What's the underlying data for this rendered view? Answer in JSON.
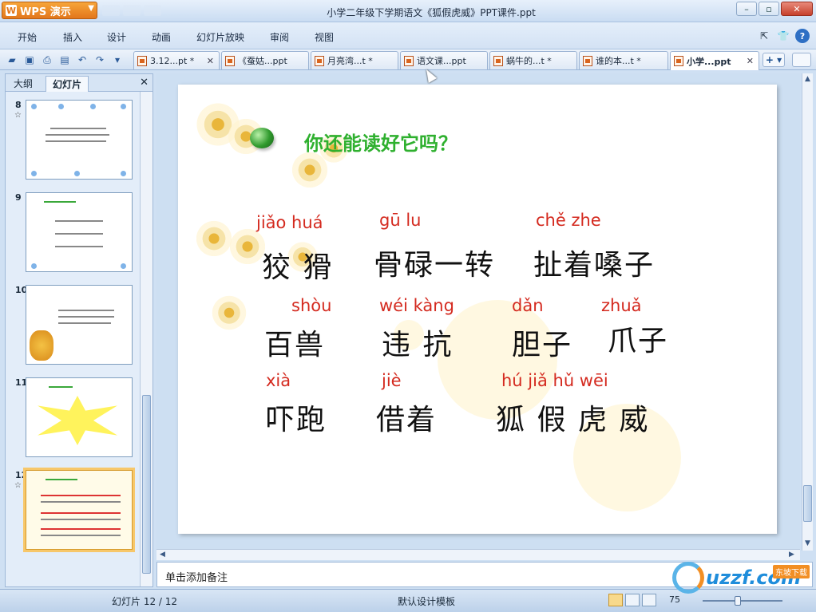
{
  "app": {
    "name": "WPS 演示",
    "window_title": "小学二年级下学期语文《狐假虎威》PPT课件.ppt"
  },
  "menu": {
    "items": [
      "开始",
      "插入",
      "设计",
      "动画",
      "幻灯片放映",
      "审阅",
      "视图"
    ]
  },
  "tabs": [
    {
      "label": "3.12...pt *",
      "active": false
    },
    {
      "label": "《蚕姑...ppt",
      "active": false
    },
    {
      "label": "月亮湾...t *",
      "active": false
    },
    {
      "label": "语文课...ppt",
      "active": false
    },
    {
      "label": "蜗牛的...t *",
      "active": false
    },
    {
      "label": "谁的本...t *",
      "active": false
    },
    {
      "label": "小学...ppt",
      "active": true
    }
  ],
  "left_panel": {
    "tabs": [
      "大纲",
      "幻灯片"
    ],
    "active_tab": "幻灯片",
    "slides": [
      {
        "number": "8",
        "star": "☆"
      },
      {
        "number": "9",
        "star": ""
      },
      {
        "number": "10",
        "star": ""
      },
      {
        "number": "11",
        "star": ""
      },
      {
        "number": "12",
        "star": "☆"
      }
    ]
  },
  "slide": {
    "title": "你还能读好它吗？",
    "rows": [
      [
        {
          "pinyin": "jiǎo huá",
          "hanzi": "狡 猾"
        },
        {
          "pinyin": "gū lu",
          "hanzi": "骨碌一转"
        },
        {
          "pinyin": "chě zhe",
          "hanzi": "扯着嗓子"
        }
      ],
      [
        {
          "pinyin": "shòu",
          "hanzi": "百兽"
        },
        {
          "pinyin": "wéi kàng",
          "hanzi": "违 抗"
        },
        {
          "pinyin": "dǎn",
          "hanzi": "胆子"
        },
        {
          "pinyin": "zhuǎ",
          "hanzi": "爪子"
        }
      ],
      [
        {
          "pinyin": "xià",
          "hanzi": "吓跑"
        },
        {
          "pinyin": "jiè",
          "hanzi": "借着"
        },
        {
          "pinyin": "hú jiǎ hǔ wēi",
          "hanzi": "狐 假 虎 威"
        }
      ]
    ]
  },
  "notes": {
    "placeholder": "单击添加备注"
  },
  "status": {
    "slide_indicator": "幻灯片 12 / 12",
    "template": "默认设计模板",
    "zoom": "75"
  },
  "watermark": {
    "text": "uzzf.com",
    "tag": "东坡下载"
  },
  "colors": {
    "pinyin": "#d42a1f",
    "title": "#2fb02f",
    "accent": "#e2761b"
  }
}
